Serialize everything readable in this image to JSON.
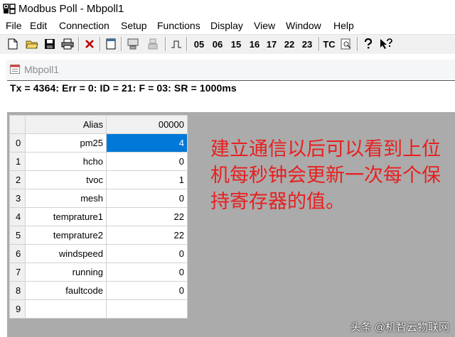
{
  "window": {
    "title": "Modbus Poll - Mbpoll1"
  },
  "menu": [
    "File",
    "Edit",
    "Connection",
    "Setup",
    "Functions",
    "Display",
    "View",
    "Window",
    "Help"
  ],
  "toolbar": {
    "function_codes": [
      "05",
      "06",
      "15",
      "16",
      "17",
      "22",
      "23"
    ],
    "tc_label": "TC"
  },
  "child": {
    "title": "Mbpoll1",
    "status": "Tx = 4364: Err = 0: ID = 21: F = 03: SR = 1000ms"
  },
  "grid": {
    "headers": {
      "alias": "Alias",
      "value": "00000"
    },
    "rows": [
      {
        "index": "0",
        "alias": "pm25",
        "value": "4"
      },
      {
        "index": "1",
        "alias": "hcho",
        "value": "0"
      },
      {
        "index": "2",
        "alias": "tvoc",
        "value": "1"
      },
      {
        "index": "3",
        "alias": "mesh",
        "value": "0"
      },
      {
        "index": "4",
        "alias": "temprature1",
        "value": "22"
      },
      {
        "index": "5",
        "alias": "temprature2",
        "value": "22"
      },
      {
        "index": "6",
        "alias": "windspeed",
        "value": "0"
      },
      {
        "index": "7",
        "alias": "running",
        "value": "0"
      },
      {
        "index": "8",
        "alias": "faultcode",
        "value": "0"
      },
      {
        "index": "9",
        "alias": "",
        "value": ""
      }
    ]
  },
  "annotation": "建立通信以后可以看到上位机每秒钟会更新一次每个保持寄存器的值。",
  "watermark": "头条 @机智云物联网",
  "colors": {
    "selection": "#0078d7",
    "annotation": "#e81f1f"
  }
}
